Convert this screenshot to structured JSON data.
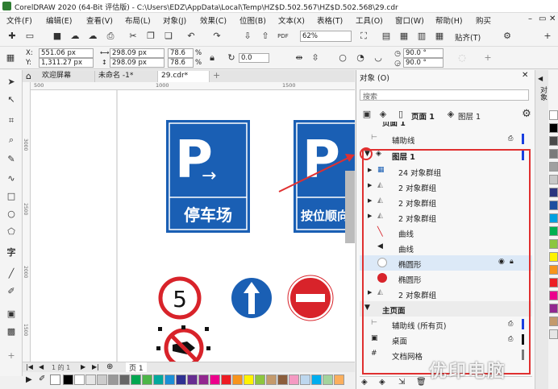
{
  "app": {
    "title": "CorelDRAW 2020 (64-Bit 评估版) - C:\\Users\\EDZ\\AppData\\Local\\Temp\\HZ$D.502.567\\HZ$D.502.568\\29.cdr"
  },
  "menu": {
    "items": [
      "文件(F)",
      "编辑(E)",
      "查看(V)",
      "布局(L)",
      "对象(J)",
      "效果(C)",
      "位图(B)",
      "文本(X)",
      "表格(T)",
      "工具(O)",
      "窗口(W)",
      "帮助(H)",
      "购买"
    ]
  },
  "toolbar": {
    "zoom": "62%",
    "paste": "贴齐(T)"
  },
  "propbar": {
    "x_label": "X:",
    "x": "551.06 px",
    "y_label": "Y:",
    "y": "1,311.27 px",
    "w": "298.09 px",
    "h": "298.09 px",
    "sx": "78.6",
    "sy": "78.6",
    "unit": "%",
    "rotation": "0.0",
    "angle1": "90.0 °",
    "angle2": "90.0 °"
  },
  "tabs": [
    "欢迎屏幕",
    "未命名 -1*",
    "29.cdr*"
  ],
  "ruler": {
    "x": [
      "500",
      "1000",
      "1500"
    ],
    "y": [
      "3000",
      "2500",
      "2000",
      "1500"
    ]
  },
  "canvas": {
    "sign1_text": "停车场",
    "sign1_letter": "P",
    "sign2_text": "按位顺向",
    "sign2_letter": "P",
    "speed_limit": "5"
  },
  "status": {
    "page_nav": "1 的 1",
    "page_tab": "页 1"
  },
  "docker": {
    "title": "对象 (O)",
    "search_placeholder": "搜索",
    "page_label": "页面 1",
    "layer_label": "图层 1",
    "rows": [
      {
        "name": "页面 1",
        "kind": "page"
      },
      {
        "name": "辅助线",
        "kind": "guides"
      },
      {
        "name": "图层 1",
        "kind": "layer"
      },
      {
        "name": "24 对象群组",
        "kind": "group"
      },
      {
        "name": "2 对象群组",
        "kind": "group"
      },
      {
        "name": "2 对象群组",
        "kind": "group"
      },
      {
        "name": "2 对象群组",
        "kind": "group"
      },
      {
        "name": "曲线",
        "kind": "curve-red"
      },
      {
        "name": "曲线",
        "kind": "curve"
      },
      {
        "name": "椭圆形",
        "kind": "ellipse-white"
      },
      {
        "name": "椭圆形",
        "kind": "ellipse-red"
      },
      {
        "name": "2 对象群组",
        "kind": "group"
      },
      {
        "name": "主页面",
        "kind": "master"
      },
      {
        "name": "辅助线 (所有页)",
        "kind": "guides"
      },
      {
        "name": "桌面",
        "kind": "desktop"
      },
      {
        "name": "文档网格",
        "kind": "grid"
      }
    ]
  },
  "dockertab": "对象",
  "watermark": "优印电脑",
  "colors": {
    "sign_blue": "#1a5fb4",
    "sign_red": "#d8232a",
    "highlight_red": "#e03030",
    "selected_row": "#dce9f7"
  },
  "palette": [
    "#000000",
    "#ffffff",
    "#e6e6e6",
    "#cccccc",
    "#999999",
    "#666666",
    "#00a650",
    "#4cb648",
    "#00a99d",
    "#1a8fd6",
    "#2e3192",
    "#662d91",
    "#92278f",
    "#ec008c",
    "#ed1c24",
    "#f7941d",
    "#fff200",
    "#8dc63f",
    "#c49a6c",
    "#8b5e3c",
    "#f49ac2",
    "#bdd7ee",
    "#00aeef",
    "#a3d39c",
    "#fbaf5d"
  ],
  "rightpalette": [
    "#ffffff",
    "#000000",
    "#4a4a4a",
    "#7a7a7a",
    "#a0a0a0",
    "#c8c8c8",
    "#2d3580",
    "#1e4fa0",
    "#00a0e0",
    "#00b050",
    "#8cc63f",
    "#fff200",
    "#f7941d",
    "#ed1c24",
    "#ec008c",
    "#92278f",
    "#c49a6c",
    "#e6e6e6"
  ]
}
